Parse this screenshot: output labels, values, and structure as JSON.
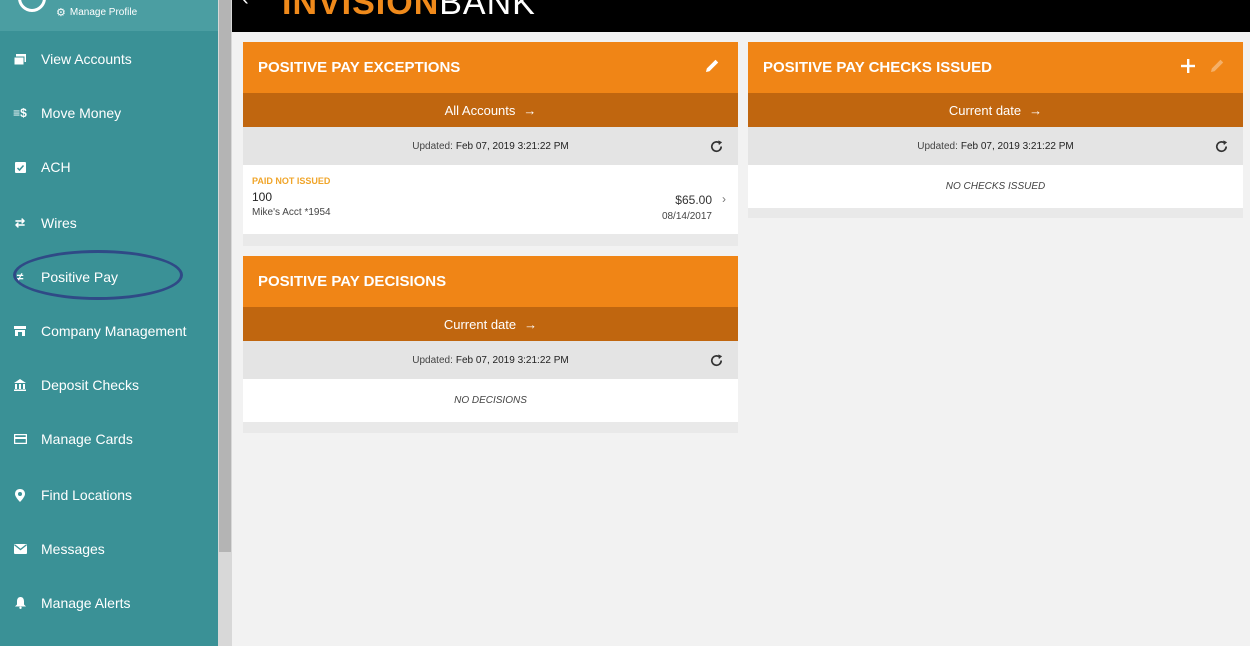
{
  "sidebar": {
    "manage_profile": "Manage Profile",
    "items": [
      {
        "label": "View Accounts",
        "icon": "accounts-icon"
      },
      {
        "label": "Move Money",
        "icon": "transfer-icon",
        "glyph": "≡$"
      },
      {
        "label": "ACH",
        "icon": "clipboard-icon"
      },
      {
        "label": "Wires",
        "icon": "swap-icon"
      },
      {
        "label": "Positive Pay",
        "icon": "check-pay-icon"
      },
      {
        "label": "Company Management",
        "icon": "company-icon"
      },
      {
        "label": "Deposit Checks",
        "icon": "bank-icon"
      },
      {
        "label": "Manage Cards",
        "icon": "card-icon"
      },
      {
        "label": "Find Locations",
        "icon": "location-pin-icon"
      },
      {
        "label": "Messages",
        "icon": "envelope-icon"
      },
      {
        "label": "Manage Alerts",
        "icon": "bell-icon"
      }
    ]
  },
  "header": {
    "brand_bold": "INVISION",
    "brand_light": "BANK"
  },
  "exceptions": {
    "title": "POSITIVE PAY EXCEPTIONS",
    "filter": "All Accounts",
    "updated_label": "Updated:",
    "updated_value": "Feb 07, 2019 3:21:22 PM",
    "item": {
      "status": "PAID NOT ISSUED",
      "number": "100",
      "account": "Mike's Acct *1954",
      "amount": "$65.00",
      "date": "08/14/2017"
    }
  },
  "decisions": {
    "title": "POSITIVE PAY DECISIONS",
    "filter": "Current date",
    "updated_label": "Updated:",
    "updated_value": "Feb 07, 2019 3:21:22 PM",
    "empty": "NO DECISIONS"
  },
  "checks_issued": {
    "title": "POSITIVE PAY CHECKS ISSUED",
    "filter": "Current date",
    "updated_label": "Updated:",
    "updated_value": "Feb 07, 2019 3:21:22 PM",
    "empty": "NO CHECKS ISSUED"
  },
  "colors": {
    "sidebar": "#3a9196",
    "accent": "#f08516",
    "accent_dark": "#c0660f",
    "status_warning": "#f0a52a",
    "highlight_ring": "#2f4a86"
  }
}
